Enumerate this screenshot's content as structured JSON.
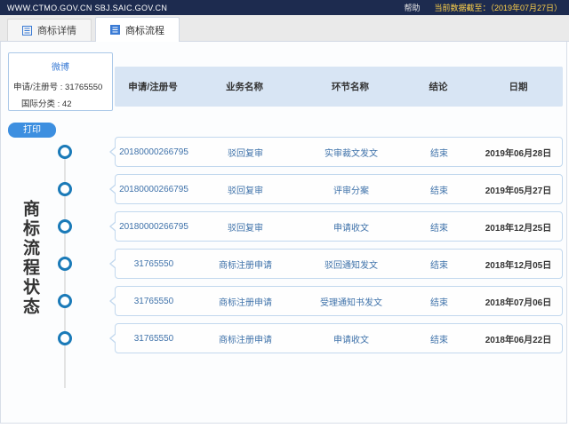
{
  "topbar": {
    "site": "WWW.CTMO.GOV.CN SBJ.SAIC.GOV.CN",
    "help": "帮助",
    "data_as_of": "当前数据截至：（2019年07月27日）"
  },
  "tabs": [
    {
      "label": "商标详情",
      "active": false
    },
    {
      "label": "商标流程",
      "active": true
    }
  ],
  "summary": {
    "name": "微博",
    "reg_no": "申请/注册号 : 31765550",
    "intl_class": "国际分类 : 42"
  },
  "print_label": "打印",
  "vertical_title": "商标流程状态",
  "table": {
    "headers": [
      "申请/注册号",
      "业务名称",
      "环节名称",
      "结论",
      "日期"
    ],
    "header_keys": [
      "reg-no",
      "business-name",
      "stage-name",
      "conclusion",
      "date"
    ],
    "rows": [
      [
        "20180000266795",
        "驳回复审",
        "实审裁文发文",
        "结束",
        "2019年06月28日"
      ],
      [
        "20180000266795",
        "驳回复审",
        "评审分案",
        "结束",
        "2019年05月27日"
      ],
      [
        "20180000266795",
        "驳回复审",
        "申请收文",
        "结束",
        "2018年12月25日"
      ],
      [
        "31765550",
        "商标注册申请",
        "驳回通知发文",
        "结束",
        "2018年12月05日"
      ],
      [
        "31765550",
        "商标注册申请",
        "受理通知书发文",
        "结束",
        "2018年07月06日"
      ],
      [
        "31765550",
        "商标注册申请",
        "申请收文",
        "结束",
        "2018年06月22日"
      ]
    ]
  },
  "colors": {
    "topbar_bg": "#1d2b4f",
    "asof_text": "#ffd24a",
    "accent_blue": "#3a7bd5",
    "header_bg": "#d8e5f4",
    "row_border": "#c2d8ee",
    "timeline_ring": "#1a7ab8",
    "print_bg": "#3d8fe0"
  }
}
